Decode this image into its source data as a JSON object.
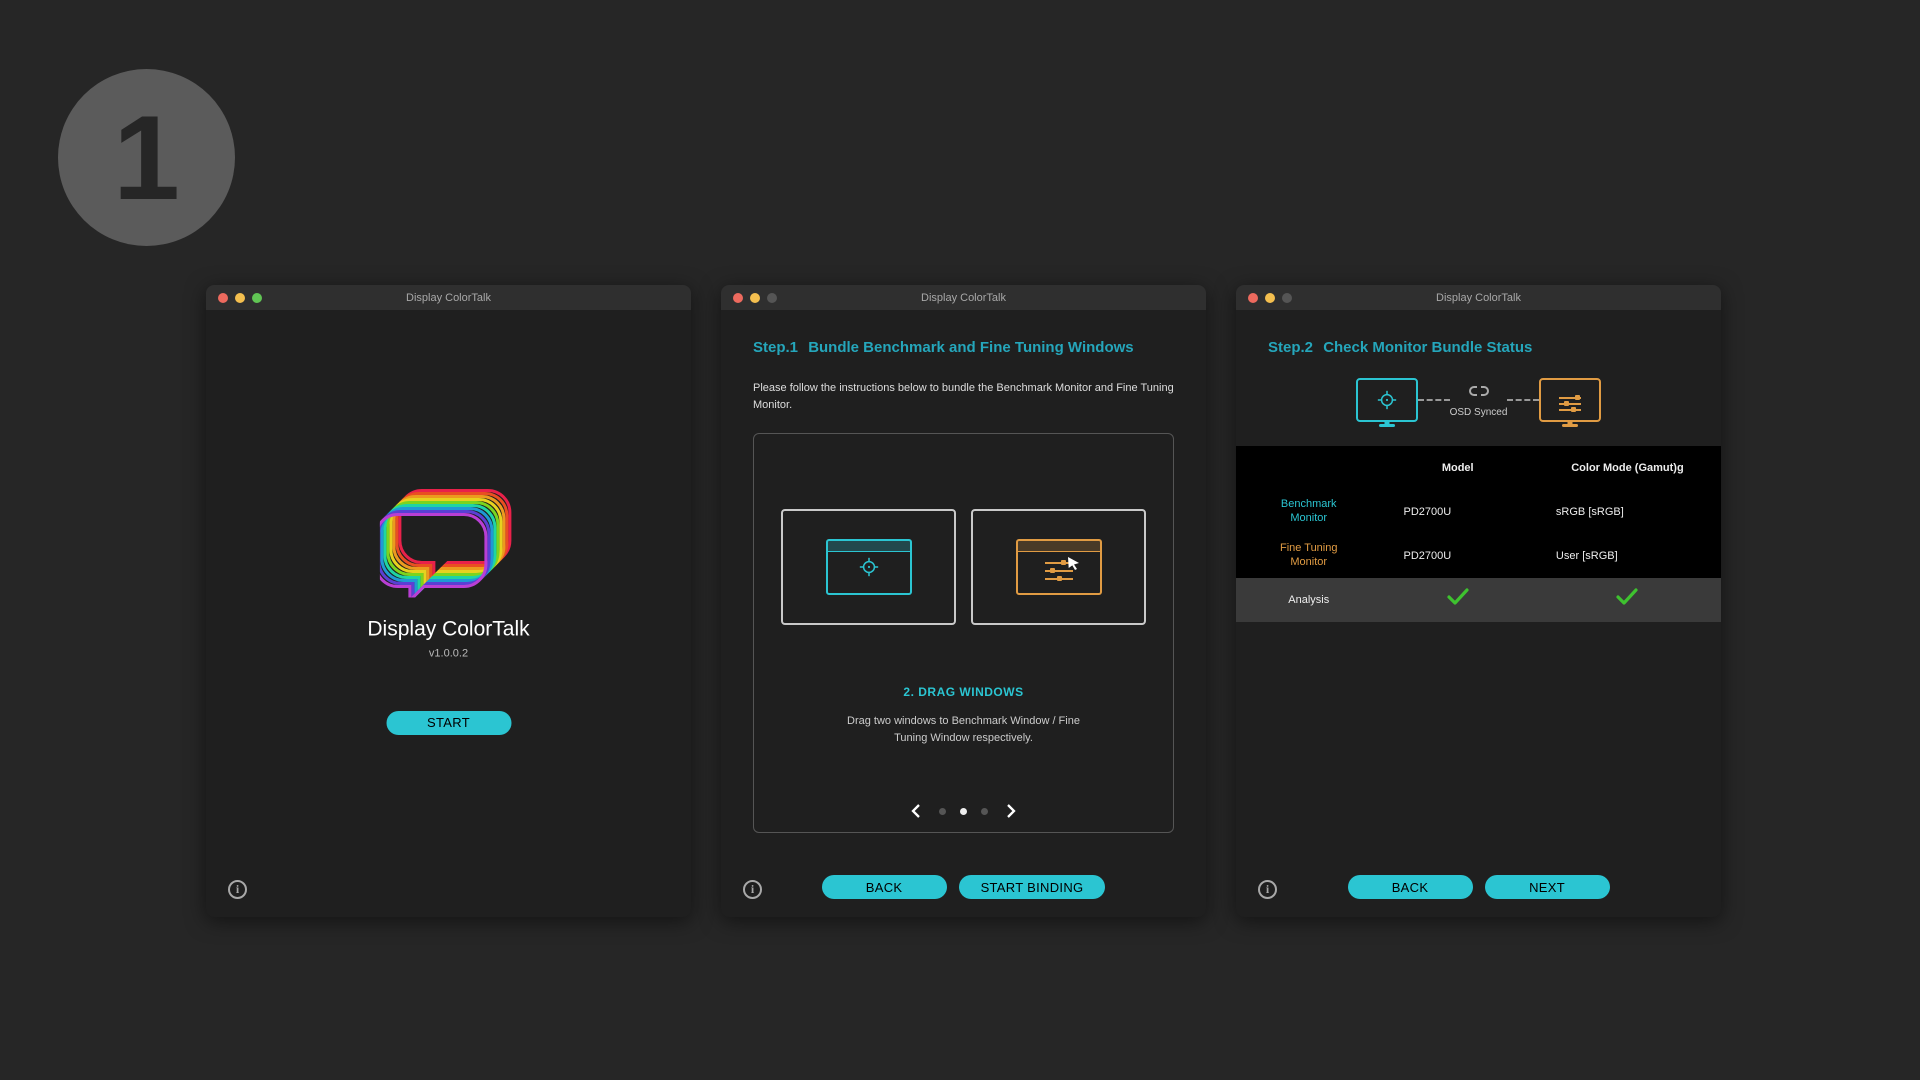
{
  "badge_number": "1",
  "colors": {
    "accent_teal": "#2bc5d2",
    "accent_orange": "#e09b43",
    "bg": "#262626",
    "panel": "#1f1f1f"
  },
  "window1": {
    "title": "Display ColorTalk",
    "app_name": "Display ColorTalk",
    "version": "v1.0.0.2",
    "start_label": "START"
  },
  "window2": {
    "title": "Display ColorTalk",
    "step_label": "Step.1",
    "step_name": "Bundle Benchmark and Fine Tuning Windows",
    "instructions": "Please follow the instructions below to bundle the Benchmark Monitor and Fine Tuning Monitor.",
    "tutorial_title": "2. DRAG WINDOWS",
    "tutorial_desc": "Drag two windows to Benchmark Window / Fine Tuning Window respectively.",
    "pager_active_index": 1,
    "pager_count": 3,
    "back_label": "BACK",
    "bind_label": "START BINDING"
  },
  "window3": {
    "title": "Display ColorTalk",
    "step_label": "Step.2",
    "step_name": "Check Monitor Bundle Status",
    "osd_label": "OSD Synced",
    "table": {
      "headers": {
        "model": "Model",
        "color_mode": "Color Mode (Gamut)g"
      },
      "rows": [
        {
          "label_line1": "Benchmark",
          "label_line2": "Monitor",
          "model": "PD2700U",
          "color_mode": "sRGB [sRGB]",
          "label_color": "teal"
        },
        {
          "label_line1": "Fine Tuning",
          "label_line2": "Monitor",
          "model": "PD2700U",
          "color_mode": "User [sRGB]",
          "label_color": "orange"
        }
      ],
      "footer_label": "Analysis",
      "footer_check_model": "✓",
      "footer_check_mode": "✓"
    },
    "back_label": "BACK",
    "next_label": "NEXT"
  }
}
